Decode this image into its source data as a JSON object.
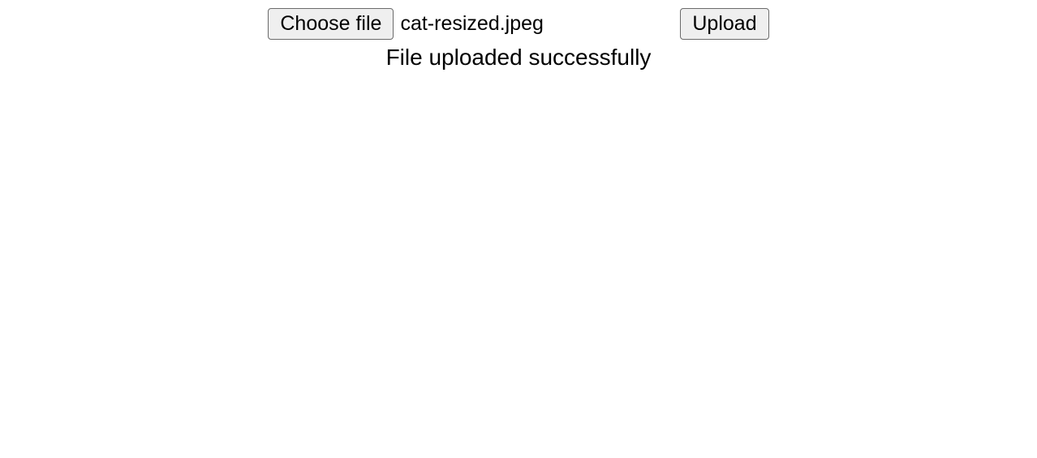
{
  "upload": {
    "choose_label": "Choose file",
    "filename": "cat-resized.jpeg",
    "upload_label": "Upload",
    "status_message": "File uploaded successfully"
  }
}
